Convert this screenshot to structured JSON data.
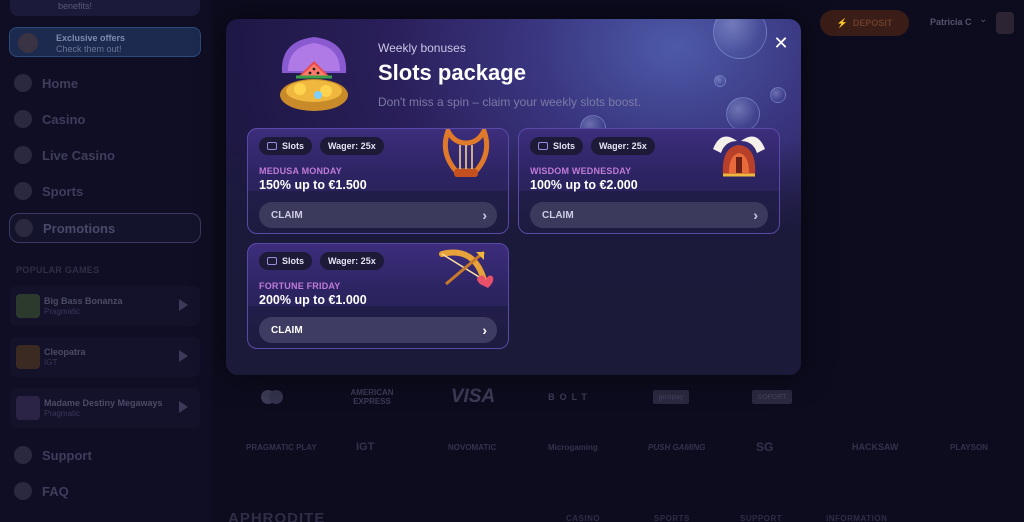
{
  "sidebar": {
    "promo_top": "benefits!",
    "exclusive": {
      "title": "Exclusive offers",
      "subtitle": "Check them out!"
    },
    "nav": [
      {
        "label": "Home",
        "icon": "home-icon"
      },
      {
        "label": "Casino",
        "icon": "casino-icon"
      },
      {
        "label": "Live Casino",
        "icon": "live-casino-icon"
      },
      {
        "label": "Sports",
        "icon": "sports-icon"
      },
      {
        "label": "Promotions",
        "icon": "promotions-icon",
        "active": true
      }
    ],
    "popular_title": "POPULAR GAMES",
    "games": [
      {
        "name": "Big Bass Bonanza",
        "provider": "Pragmatic"
      },
      {
        "name": "Cleopatra",
        "provider": "IGT"
      },
      {
        "name": "Madame Destiny Megaways",
        "provider": "Pragmatic"
      }
    ],
    "bottom_nav": [
      {
        "label": "Support",
        "icon": "support-icon"
      },
      {
        "label": "FAQ",
        "icon": "faq-icon"
      }
    ]
  },
  "topbar": {
    "deposit_label": "DEPOSIT",
    "user_name": "Patricia C"
  },
  "modal": {
    "eyebrow": "Weekly bonuses",
    "title": "Slots package",
    "subtitle": "Don't miss a spin – claim your weekly slots boost.",
    "close_icon": "close-icon",
    "cards": [
      {
        "tag": "Slots",
        "wager": "Wager: 25x",
        "name": "MEDUSA MONDAY",
        "offer": "150% up to €1.500",
        "claim": "CLAIM",
        "art": "lyre-icon"
      },
      {
        "tag": "Slots",
        "wager": "Wager: 25x",
        "name": "WISDOM WEDNESDAY",
        "offer": "100% up to €2.000",
        "claim": "CLAIM",
        "art": "winged-helmet-icon"
      },
      {
        "tag": "Slots",
        "wager": "Wager: 25x",
        "name": "FORTUNE FRIDAY",
        "offer": "200% up to €1.000",
        "claim": "CLAIM",
        "art": "bow-and-arrow-icon"
      }
    ]
  },
  "payments": [
    "AMERICAN EXPRESS",
    "VISA",
    "BOLT",
    "giropay",
    "SOFORT"
  ],
  "providers": [
    "PRAGMATIC PLAY",
    "IGT",
    "NOVOMATIC",
    "Microgaming",
    "PUSH GAMING",
    "SG",
    "HACKSAW",
    "PLAYSON"
  ],
  "footer": {
    "logo": "APHRODITE",
    "links": [
      "CASINO",
      "SPORTS",
      "SUPPORT",
      "INFORMATION"
    ]
  },
  "colors": {
    "accent_purple": "#c07ad8",
    "card_border": "#5a4aa8",
    "modal_bg": "#1b1a38"
  }
}
